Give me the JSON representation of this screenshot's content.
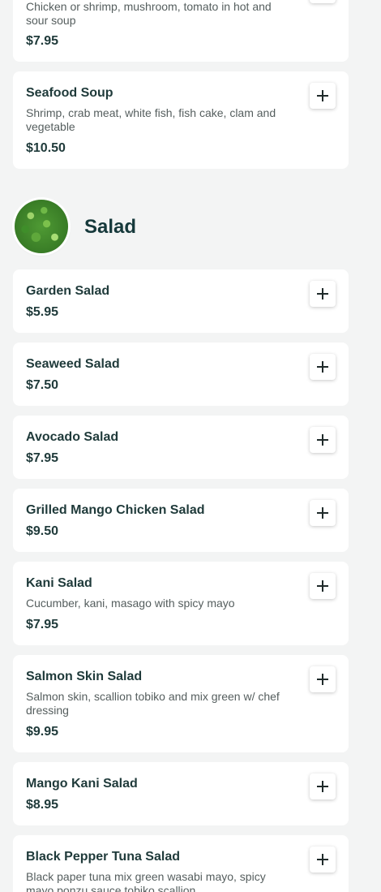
{
  "sections": {
    "soup_tail": {
      "items": [
        {
          "desc": "Chicken or shrimp, mushroom, tomato in hot and sour soup",
          "price": "$7.95"
        },
        {
          "name": "Seafood Soup",
          "desc": "Shrimp, crab meat, white fish, fish cake, clam and vegetable",
          "price": "$10.50"
        }
      ]
    },
    "salad": {
      "title": "Salad",
      "image_icon": "seaweed-salad-image",
      "items": [
        {
          "name": "Garden Salad",
          "price": "$5.95"
        },
        {
          "name": "Seaweed Salad",
          "price": "$7.50"
        },
        {
          "name": "Avocado Salad",
          "price": "$7.95"
        },
        {
          "name": "Grilled Mango Chicken Salad",
          "price": "$9.50"
        },
        {
          "name": "Kani Salad",
          "desc": "Cucumber, kani, masago with spicy mayo",
          "price": "$7.95"
        },
        {
          "name": "Salmon Skin Salad",
          "desc": "Salmon skin, scallion tobiko and mix green w/ chef dressing",
          "price": "$9.95"
        },
        {
          "name": "Mango Kani Salad",
          "price": "$8.95"
        },
        {
          "name": "Black Pepper Tuna Salad",
          "desc": "Black paper tuna mix green wasabi mayo, spicy mayo ponzu sauce tobiko scallion",
          "price": ""
        }
      ]
    }
  },
  "icons": {
    "add": "plus-icon"
  },
  "colors": {
    "background": "#f3f4f4",
    "card": "#ffffff",
    "text_dark": "#1f3a3a",
    "text_muted": "#555e5e"
  }
}
